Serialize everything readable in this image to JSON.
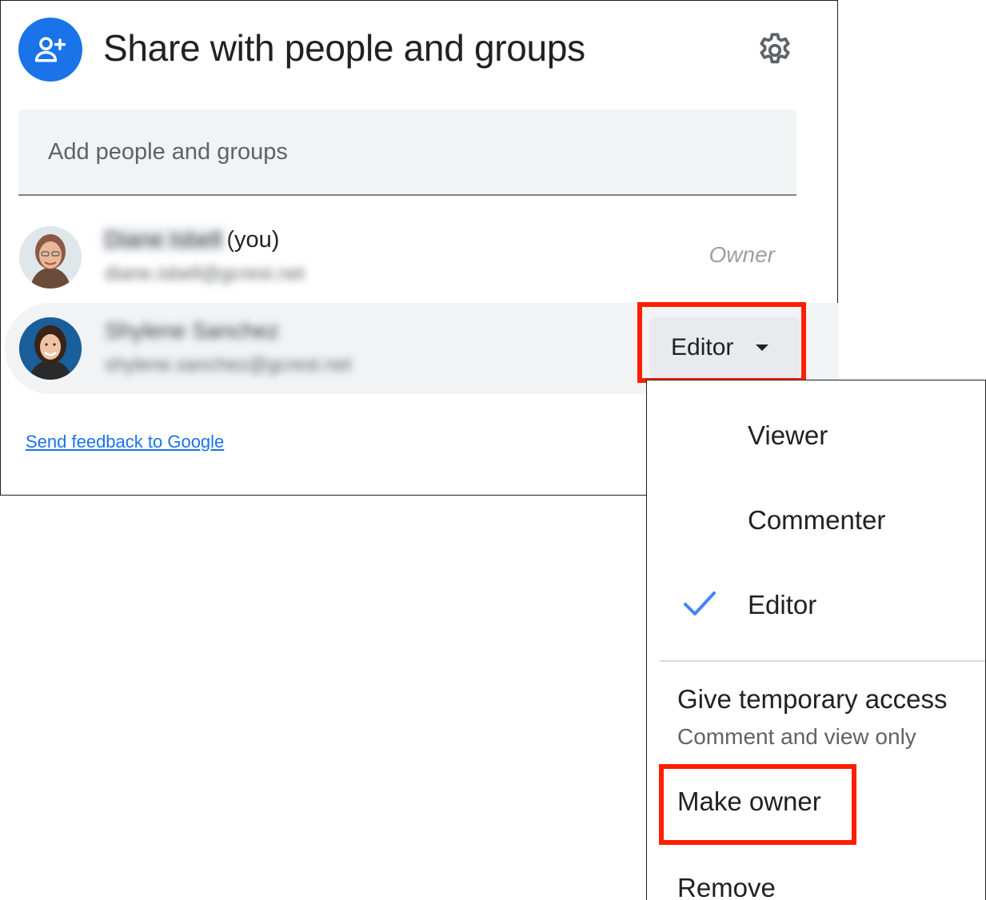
{
  "dialog": {
    "title": "Share with people and groups",
    "header_icon": "person-add-icon",
    "settings_icon": "gear-icon",
    "search": {
      "placeholder": "Add people and groups",
      "value": ""
    },
    "people": [
      {
        "name": "Diane Isbell",
        "suffix": "(you)",
        "email": "diane.isbell@gcrest.net",
        "role": "Owner"
      },
      {
        "name": "Shylene Sanchez",
        "email": "shylene.sanchez@gcrest.net",
        "role": "Editor"
      }
    ],
    "feedback_link": "Send feedback to Google"
  },
  "role_menu": {
    "items": [
      {
        "label": "Viewer",
        "selected": false
      },
      {
        "label": "Commenter",
        "selected": false
      },
      {
        "label": "Editor",
        "selected": true
      }
    ],
    "temporary_access": {
      "label": "Give temporary access",
      "sublabel": "Comment and view only"
    },
    "make_owner": "Make owner",
    "remove": "Remove"
  },
  "colors": {
    "accent": "#1a73e8",
    "highlight": "#ff1f00",
    "row_selected": "#f1f3f4"
  }
}
